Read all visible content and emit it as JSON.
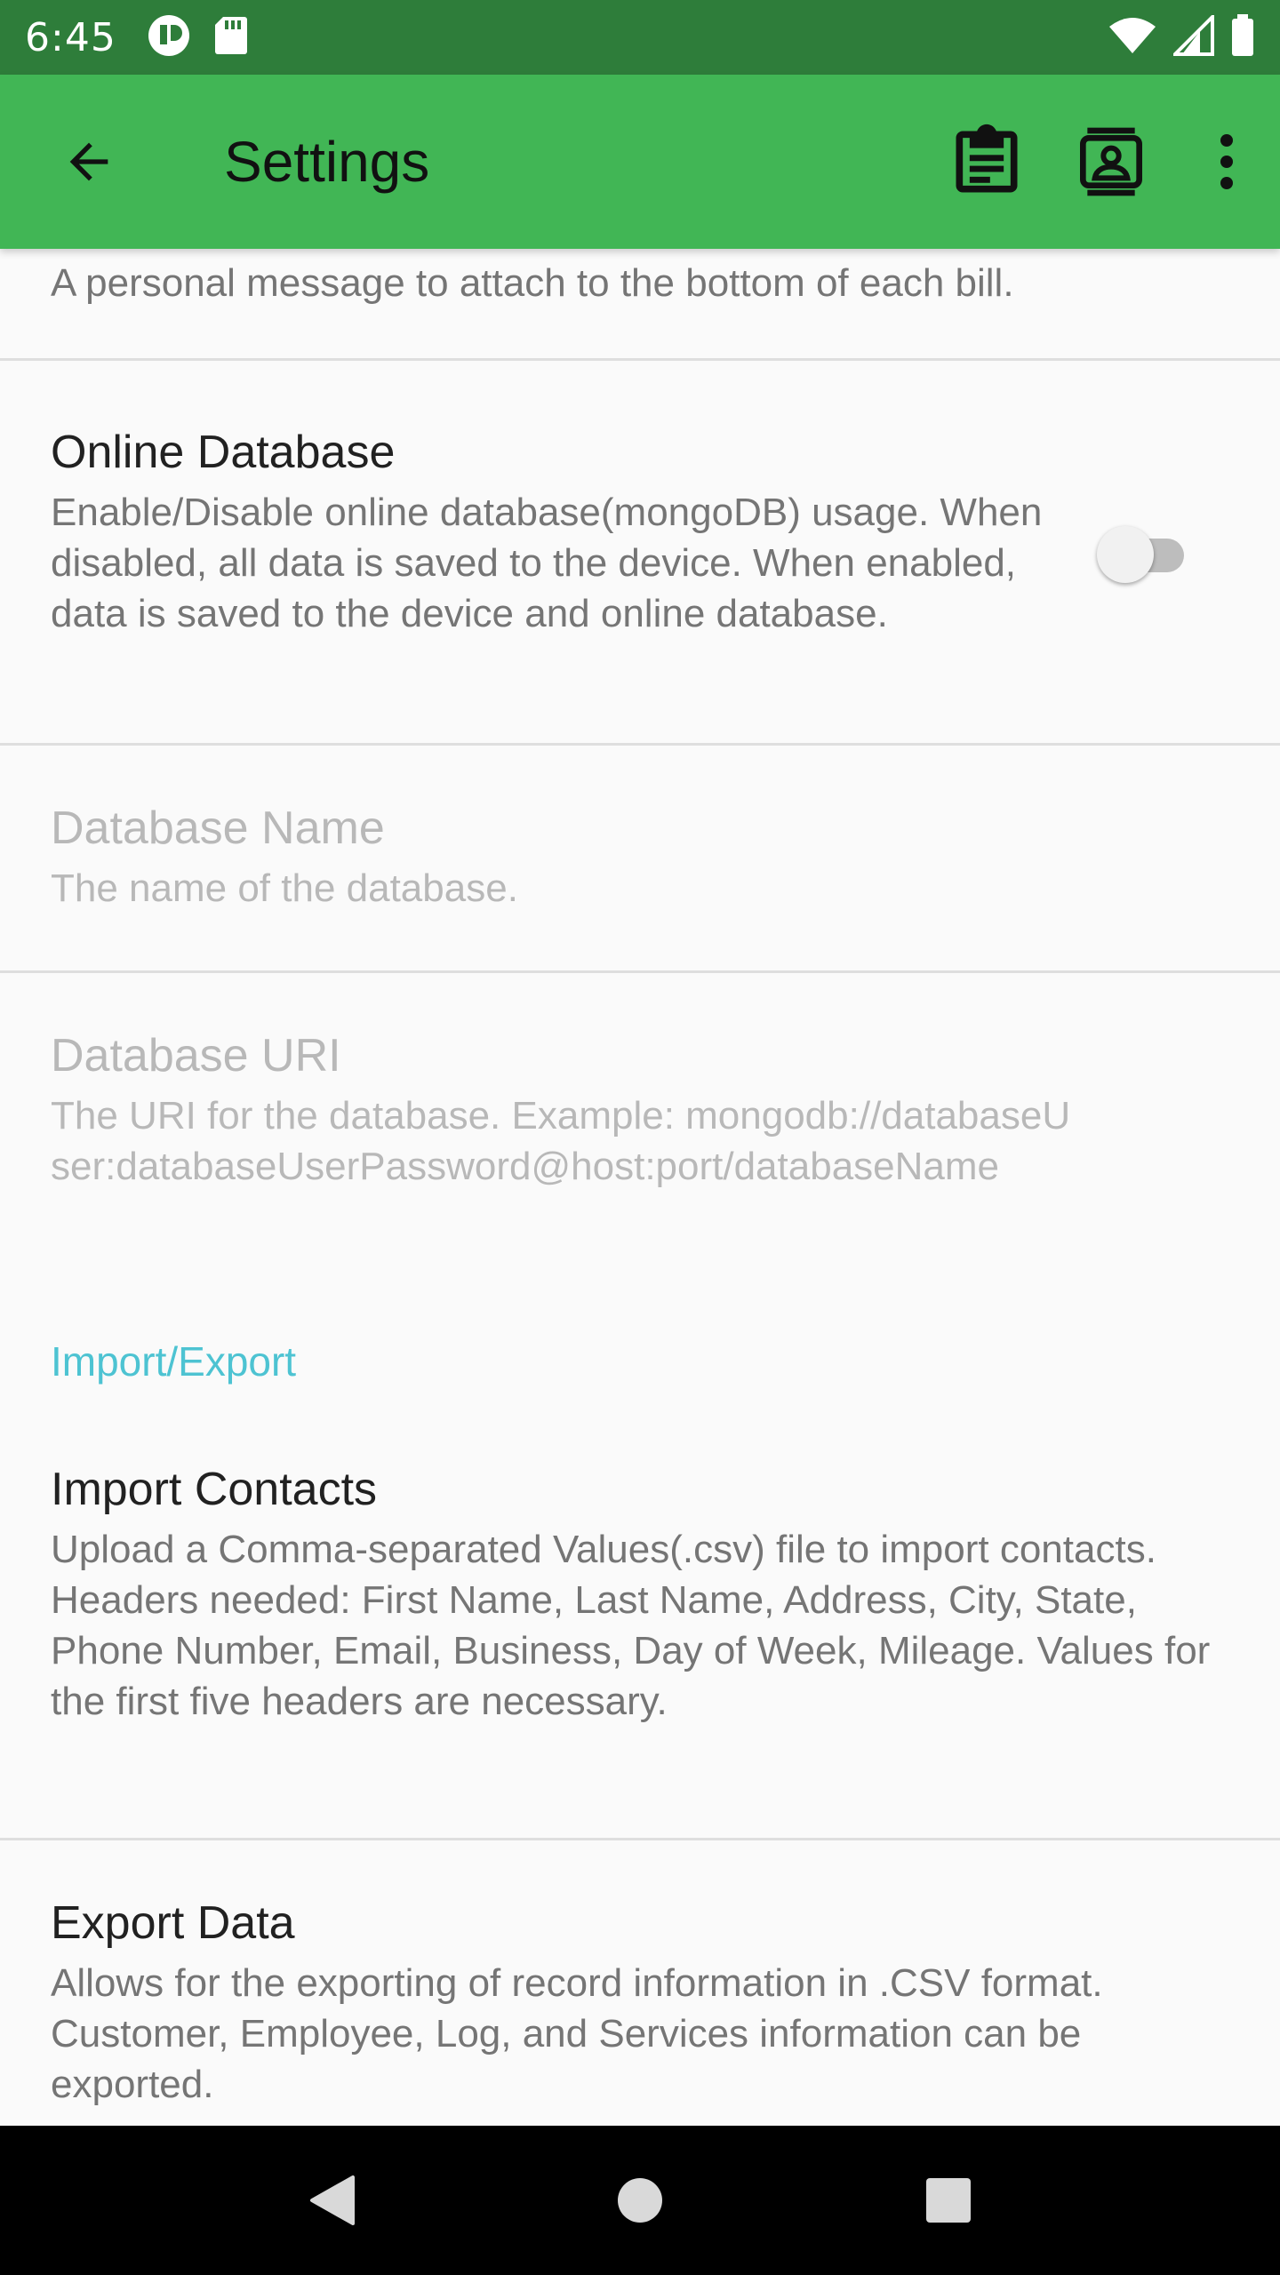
{
  "status_bar": {
    "time": "6:45",
    "icons_left": [
      "app-notification-icon",
      "sd-card-icon"
    ],
    "icons_right": [
      "wifi-icon",
      "cell-signal-icon",
      "battery-icon"
    ]
  },
  "app_bar": {
    "title": "Settings",
    "back_icon": "arrow-back-icon",
    "actions": [
      "clipboard-icon",
      "contacts-icon",
      "more-vert-icon"
    ]
  },
  "preferences": {
    "bill_message": {
      "summary": "A personal message to attach to the bottom of each bill."
    },
    "online_database": {
      "title": "Online Database",
      "summary": "Enable/Disable online database(mongoDB) usage. When disabled, all data is saved to the device. When enabled, data is saved to the device and online database.",
      "enabled": false
    },
    "database_name": {
      "title": "Database Name",
      "summary": "The name of the database."
    },
    "database_uri": {
      "title": "Database URI",
      "summary": "The URI for the database. Example: mongodb://databaseUser:databaseUserPassword@host:port/databaseName"
    },
    "import_export_category": "Import/Export",
    "import_contacts": {
      "title": "Import Contacts",
      "summary": "Upload a Comma-separated Values(.csv) file to import contacts. Headers needed: First Name, Last Name, Address, City, State, Phone Number, Email, Business, Day of Week, Mileage. Values for the first five headers are necessary."
    },
    "export_data": {
      "title": "Export Data",
      "summary": "Allows for the exporting of record information in .CSV format. Customer, Employee, Log, and Services information can be exported."
    }
  },
  "colors": {
    "status_bar": "#2e7d3a",
    "app_bar": "#41b655",
    "category_accent": "#4dc3d2"
  },
  "nav_bar": [
    "back-triangle-icon",
    "home-circle-icon",
    "recents-square-icon"
  ]
}
